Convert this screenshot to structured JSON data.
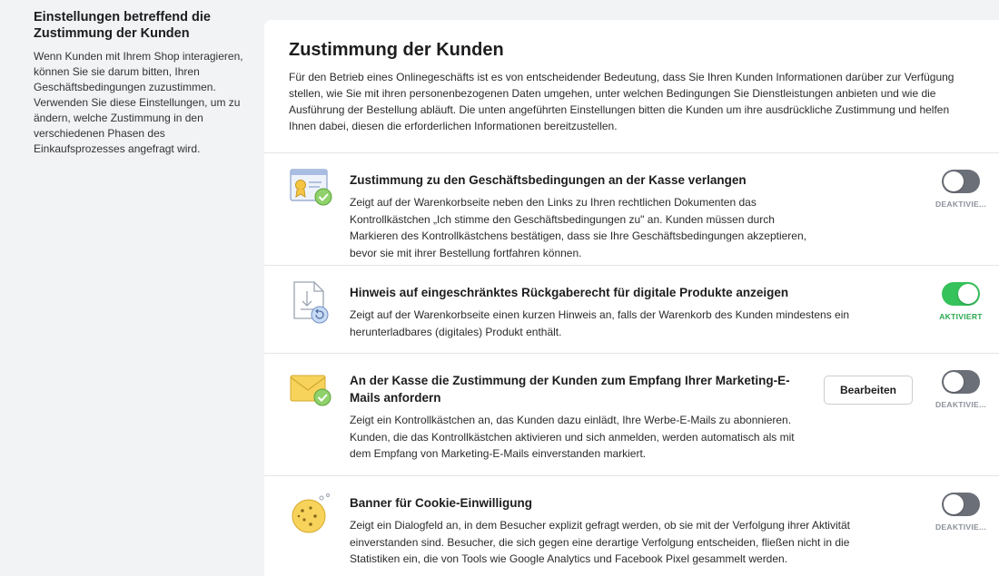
{
  "sidebar": {
    "title": "Einstellungen betreffend die Zustimmung der Kunden",
    "description": "Wenn Kunden mit Ihrem Shop interagieren, können Sie sie darum bitten, Ihren Geschäftsbedingungen zuzustimmen. Verwenden Sie diese Einstellungen, um zu ändern, welche Zustimmung in den verschiedenen Phasen des Einkaufsprozesses angefragt wird."
  },
  "panel": {
    "title": "Zustimmung der Kunden",
    "intro": "Für den Betrieb eines Onlinegeschäfts ist es von entscheidender Bedeutung, dass Sie Ihren Kunden Informationen darüber zur Verfügung stellen, wie Sie mit ihren personenbezogenen Daten umgehen, unter welchen Bedingungen Sie Dienstleistungen anbieten und wie die Ausführung der Bestellung abläuft. Die unten angeführten Einstellungen bitten die Kunden um ihre ausdrückliche Zustimmung und helfen Ihnen dabei, diesen die erforderlichen Informationen bereitzustellen."
  },
  "settings": [
    {
      "title": "Zustimmung zu den Geschäftsbedingungen an der Kasse verlangen",
      "description": "Zeigt auf der Warenkorbseite neben den Links zu Ihren rechtlichen Dokumenten das Kontrollkästchen „Ich stimme den Geschäftsbedingungen zu\" an. Kunden müssen durch Markieren des Kontrollkästchens bestätigen, dass sie Ihre Geschäftsbedingungen akzeptieren, bevor sie mit ihrer Bestellung fortfahren können.",
      "enabled": false,
      "status_label": "DEAKTIVIE...",
      "icon": "certificate-check-icon"
    },
    {
      "title": "Hinweis auf eingeschränktes Rückgaberecht für digitale Produkte anzeigen",
      "description": "Zeigt auf der Warenkorbseite einen kurzen Hinweis an, falls der Warenkorb des Kunden mindestens ein herunterladbares (digitales) Produkt enthält.",
      "enabled": true,
      "status_label": "AKTIVIERT",
      "icon": "download-return-icon"
    },
    {
      "title": "An der Kasse die Zustimmung der Kunden zum Empfang Ihrer Marketing-E-Mails anfordern",
      "description": "Zeigt ein Kontrollkästchen an, das Kunden dazu einlädt, Ihre Werbe-E-Mails zu abonnieren. Kunden, die das Kontrollkästchen aktivieren und sich anmelden, werden automatisch als mit dem Empfang von Marketing-E-Mails einverstanden markiert.",
      "enabled": false,
      "status_label": "DEAKTIVIE...",
      "edit_label": "Bearbeiten",
      "icon": "envelope-check-icon"
    },
    {
      "title": "Banner für Cookie-Einwilligung",
      "description": "Zeigt ein Dialogfeld an, in dem Besucher explizit gefragt werden, ob sie mit der Verfolgung ihrer Aktivität einverstanden sind. Besucher, die sich gegen eine derartige Verfolgung entscheiden, fließen nicht in die Statistiken ein, die von Tools wie Google Analytics und Facebook Pixel gesammelt werden.",
      "enabled": false,
      "status_label": "DEAKTIVIE...",
      "icon": "cookie-icon"
    }
  ],
  "colors": {
    "toggle_on": "#35c25a",
    "toggle_off": "#6b6f78",
    "status_on": "#2aa84f",
    "status_off": "#8c919a"
  }
}
